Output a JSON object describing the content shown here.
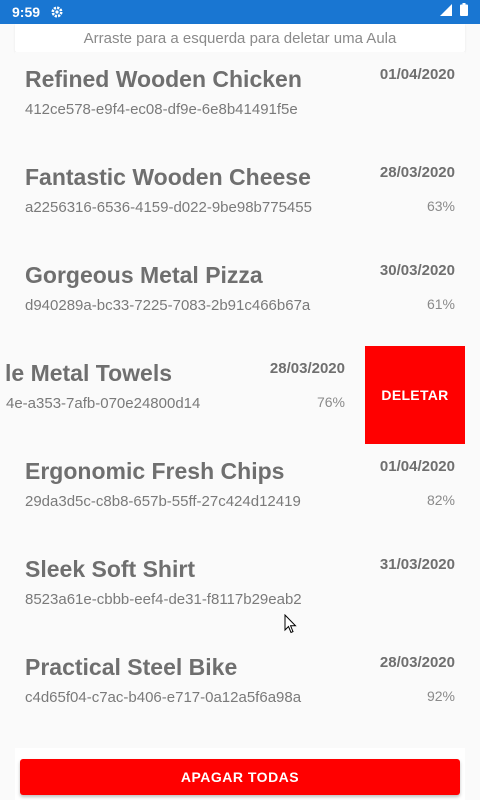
{
  "status_bar": {
    "time": "9:59",
    "gear_icon": "gear-icon",
    "signal_icon": "cellular-signal-icon",
    "battery_icon": "battery-icon"
  },
  "hint": "Arraste para a esquerda para deletar uma Aula",
  "rows": [
    {
      "name": "Refined Wooden Chicken",
      "uuid": "412ce578-e9f4-ec08-df9e-6e8b41491f5e",
      "date": "01/04/2020",
      "pct": ""
    },
    {
      "name": "Fantastic Wooden Cheese",
      "uuid": "a2256316-6536-4159-d022-9be98b775455",
      "date": "28/03/2020",
      "pct": "63%"
    },
    {
      "name": "Gorgeous Metal Pizza",
      "uuid": "d940289a-bc33-7225-7083-2b91c466b67a",
      "date": "30/03/2020",
      "pct": "61%"
    },
    {
      "name": "le Metal Towels",
      "uuid": "4e-a353-7afb-070e24800d14",
      "date": "28/03/2020",
      "pct": "76%",
      "delete_label": "DELETAR"
    },
    {
      "name": "Ergonomic Fresh Chips",
      "uuid": "29da3d5c-c8b8-657b-55ff-27c424d12419",
      "date": "01/04/2020",
      "pct": "82%"
    },
    {
      "name": "Sleek Soft Shirt",
      "uuid": "8523a61e-cbbb-eef4-de31-f8117b29eab2",
      "date": "31/03/2020",
      "pct": ""
    },
    {
      "name": "Practical Steel Bike",
      "uuid": "c4d65f04-c7ac-b406-e717-0a12a5f6a98a",
      "date": "28/03/2020",
      "pct": "92%"
    }
  ],
  "footer": {
    "apagar_label": "APAGAR TODAS"
  },
  "colors": {
    "status_bar": "#1976d2",
    "danger": "#ff0000",
    "text": "#6f6f6f"
  }
}
